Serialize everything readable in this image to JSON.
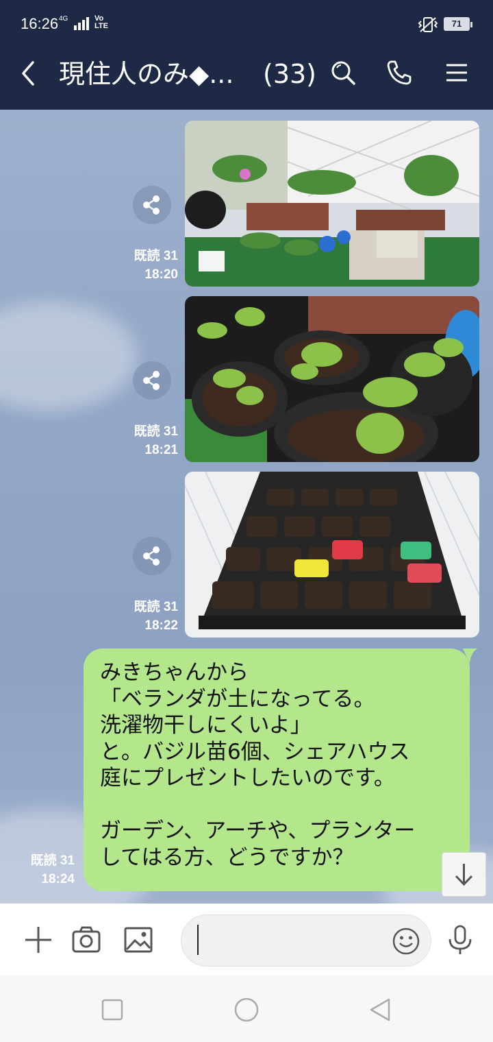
{
  "status_bar": {
    "time": "16:26",
    "network": "4G",
    "volte": "Vo LTE",
    "battery": "71",
    "icons": [
      "signal-icon",
      "vibrate-icon",
      "battery-icon"
    ]
  },
  "header": {
    "title": "現住人のみ◆...",
    "member_count": "(33)",
    "icons": [
      "back-icon",
      "search-icon",
      "phone-icon",
      "menu-icon"
    ],
    "bg_color": "#1e2a45"
  },
  "messages": [
    {
      "type": "image",
      "description_icon": "photo",
      "read": "既読 31",
      "time": "18:20"
    },
    {
      "type": "image",
      "description_icon": "photo",
      "read": "既読 31",
      "time": "18:21"
    },
    {
      "type": "image",
      "description_icon": "photo",
      "read": "既読 31",
      "time": "18:22"
    },
    {
      "type": "text",
      "read": "既読 31",
      "time": "18:24",
      "lines": [
        "みきちゃんから",
        "「ベランダが土になってる。",
        "洗濯物干しにくいよ」",
        "と。バジル苗6個、シェアハウス",
        "庭にプレゼントしたいのです。",
        "",
        "ガーデン、アーチや、プランター",
        "してはる方、どうですか？"
      ],
      "bubble_color": "#b4e68b"
    }
  ],
  "input_bar": {
    "placeholder": "",
    "icons": [
      "plus-icon",
      "camera-icon",
      "image-icon",
      "emoji-icon",
      "mic-icon"
    ]
  },
  "nav_bar": {
    "icons": [
      "recent-apps-icon",
      "home-icon",
      "back-nav-icon"
    ]
  }
}
